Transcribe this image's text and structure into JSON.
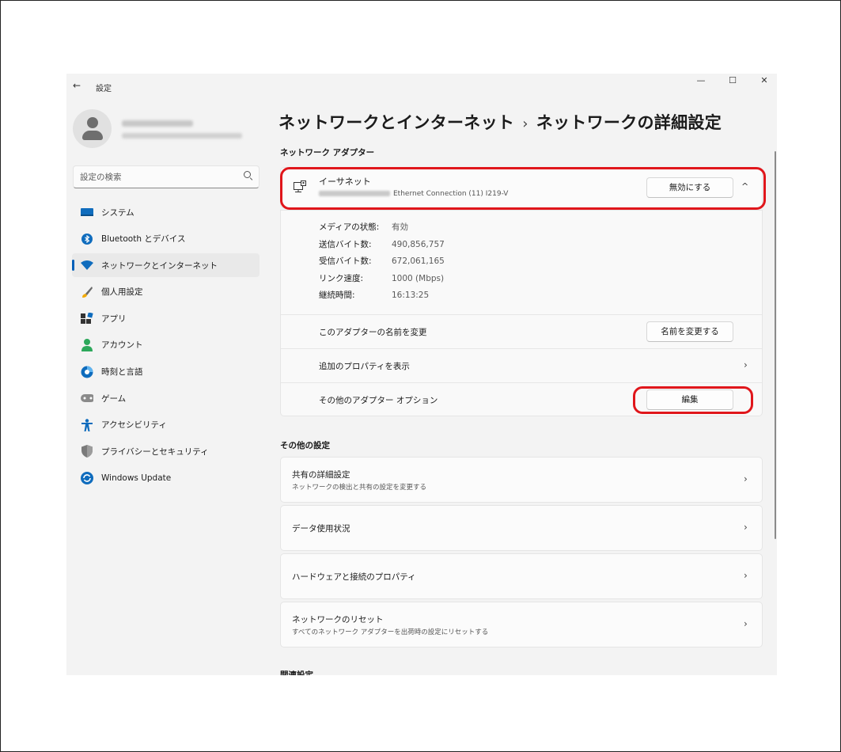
{
  "window": {
    "back_glyph": "←",
    "title": "設定",
    "minimize_glyph": "—",
    "maximize_glyph": "☐",
    "close_glyph": "✕"
  },
  "search": {
    "placeholder": "設定の検索"
  },
  "sidebar": {
    "items": [
      {
        "label": "システム",
        "icon": "system-icon",
        "active": false
      },
      {
        "label": "Bluetooth とデバイス",
        "icon": "bluetooth-icon",
        "active": false
      },
      {
        "label": "ネットワークとインターネット",
        "icon": "wifi-icon",
        "active": true
      },
      {
        "label": "個人用設定",
        "icon": "brush-icon",
        "active": false
      },
      {
        "label": "アプリ",
        "icon": "apps-icon",
        "active": false
      },
      {
        "label": "アカウント",
        "icon": "account-icon",
        "active": false
      },
      {
        "label": "時刻と言語",
        "icon": "time-language-icon",
        "active": false
      },
      {
        "label": "ゲーム",
        "icon": "game-icon",
        "active": false
      },
      {
        "label": "アクセシビリティ",
        "icon": "accessibility-icon",
        "active": false
      },
      {
        "label": "プライバシーとセキュリティ",
        "icon": "shield-icon",
        "active": false
      },
      {
        "label": "Windows Update",
        "icon": "update-icon",
        "active": false
      }
    ]
  },
  "header": {
    "parent": "ネットワークとインターネット",
    "separator": "›",
    "current": "ネットワークの詳細設定"
  },
  "adapters_section": "ネットワーク アダプター",
  "adapter": {
    "name": "イーサネット",
    "description": "Ethernet Connection (11) I219-V",
    "disable_button": "無効にする",
    "collapse_glyph": "^",
    "properties": [
      {
        "key": "メディアの状態:",
        "value": "有効"
      },
      {
        "key": "送信バイト数:",
        "value": "490,856,757"
      },
      {
        "key": "受信バイト数:",
        "value": "672,061,165"
      },
      {
        "key": "リンク速度:",
        "value": "1000 (Mbps)"
      },
      {
        "key": "継続時間:",
        "value": "16:13:25"
      }
    ],
    "rename_label": "このアダプターの名前を変更",
    "rename_button": "名前を変更する",
    "view_props_label": "追加のプロパティを表示",
    "more_options_label": "その他のアダプター オプション",
    "edit_button": "編集"
  },
  "other_section": "その他の設定",
  "other": {
    "sharing_title": "共有の詳細設定",
    "sharing_desc": "ネットワークの検出と共有の設定を変更する",
    "data_usage": "データ使用状況",
    "hw_props": "ハードウェアと接続のプロパティ",
    "reset_title": "ネットワークのリセット",
    "reset_desc": "すべてのネットワーク アダプターを出荷時の設定にリセットする"
  },
  "related_section": "関連設定",
  "chevron_glyph": "›",
  "colors": {
    "accent": "#005fb8",
    "highlight": "#e0161b"
  }
}
